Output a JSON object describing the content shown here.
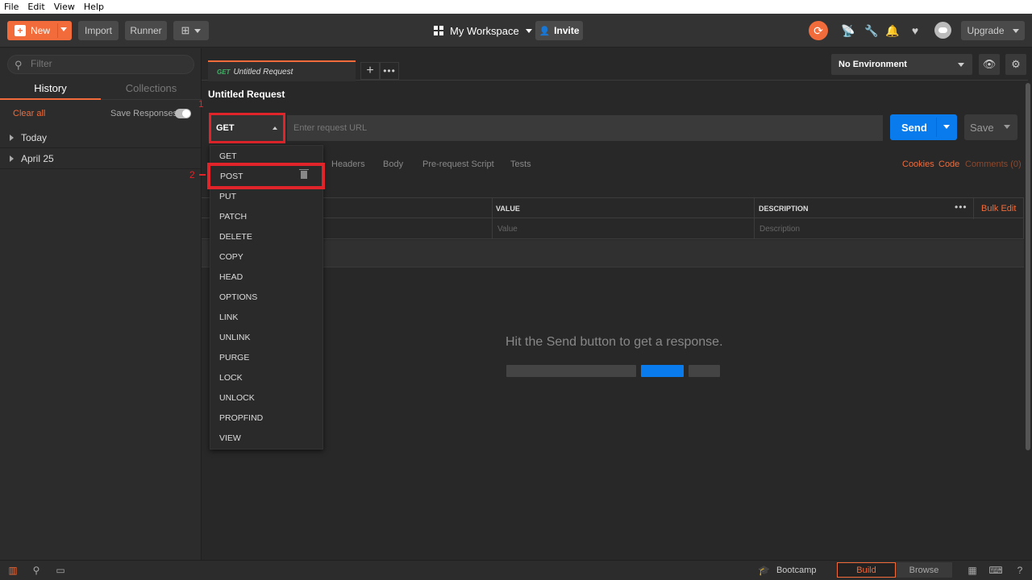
{
  "menubar": {
    "items": [
      "File",
      "Edit",
      "View",
      "Help"
    ]
  },
  "header": {
    "new_label": "New",
    "import_label": "Import",
    "runner_label": "Runner",
    "workspace_label": "My Workspace",
    "invite_label": "Invite",
    "upgrade_label": "Upgrade",
    "accent_color": "#f26b3a"
  },
  "sidebar": {
    "filter_placeholder": "Filter",
    "tabs": [
      "History",
      "Collections"
    ],
    "clear_all": "Clear all",
    "save_responses": "Save Responses",
    "save_responses_on": true,
    "groups": [
      "Today",
      "April 25"
    ]
  },
  "request": {
    "tab_method": "GET",
    "tab_name": "Untitled Request",
    "title": "Untitled Request",
    "method": "GET",
    "url_placeholder": "Enter request URL",
    "send_label": "Send",
    "save_label": "Save",
    "tabs": [
      "Headers",
      "Body",
      "Pre-request Script",
      "Tests"
    ],
    "links": {
      "cookies": "Cookies",
      "code": "Code",
      "comments": "Comments (0)"
    }
  },
  "environment": {
    "selected": "No Environment"
  },
  "params": {
    "columns": [
      "VALUE",
      "DESCRIPTION"
    ],
    "bulk_edit": "Bulk Edit",
    "value_placeholder": "Value",
    "description_placeholder": "Description"
  },
  "response": {
    "empty_message": "Hit the Send button to get a response."
  },
  "method_dropdown": {
    "options": [
      "GET",
      "POST",
      "PUT",
      "PATCH",
      "DELETE",
      "COPY",
      "HEAD",
      "OPTIONS",
      "LINK",
      "UNLINK",
      "PURGE",
      "LOCK",
      "UNLOCK",
      "PROPFIND",
      "VIEW"
    ],
    "highlighted": "POST"
  },
  "annotations": {
    "step1": "1",
    "step2": "2",
    "highlight_color": "#e0242a"
  },
  "bottombar": {
    "bootcamp": "Bootcamp",
    "build": "Build",
    "browse": "Browse"
  }
}
